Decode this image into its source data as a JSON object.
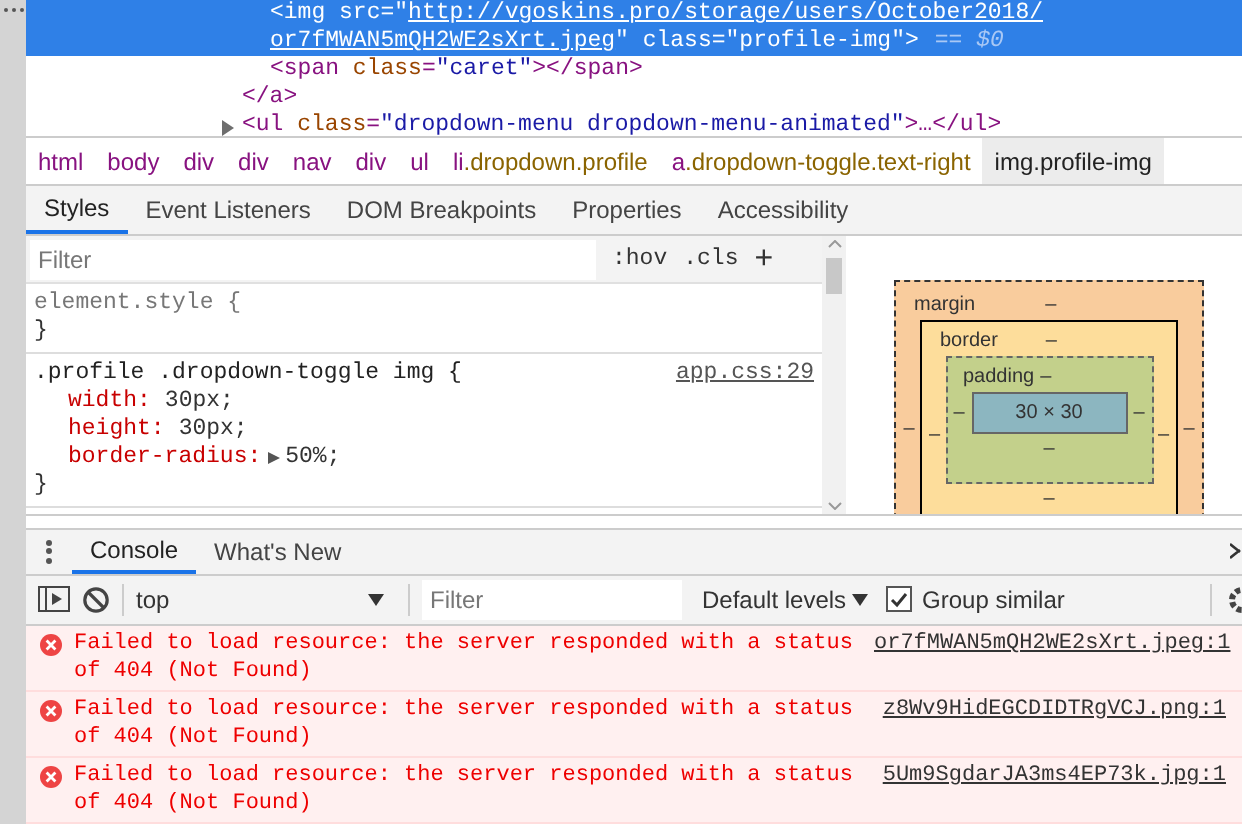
{
  "dom": {
    "inner_nodes": [
      {
        "selected": true,
        "expandable": false,
        "lines": [
          [
            {
              "kind": "tag",
              "text": "<img "
            },
            {
              "kind": "attr",
              "text": "src"
            },
            {
              "kind": "tag",
              "text": "=\""
            },
            {
              "kind": "link",
              "text": "http://vgoskins.pro/storage/users/October2018/"
            }
          ],
          [
            {
              "kind": "link",
              "text": "or7fMWAN5mQH2WE2sXrt.jpeg"
            },
            {
              "kind": "tag",
              "text": "\" "
            },
            {
              "kind": "attr",
              "text": "class"
            },
            {
              "kind": "tag",
              "text": "="
            },
            {
              "kind": "value",
              "text": "\"profile-img\""
            },
            {
              "kind": "tag",
              "text": ">"
            }
          ]
        ],
        "marker": "== $0"
      },
      {
        "selected": false,
        "expandable": false,
        "lines": [
          [
            {
              "kind": "tag",
              "text": "<span "
            },
            {
              "kind": "attr",
              "text": "class"
            },
            {
              "kind": "tag",
              "text": "="
            },
            {
              "kind": "value",
              "text": "\"caret\""
            },
            {
              "kind": "tag",
              "text": "></span>"
            }
          ]
        ]
      }
    ],
    "outer_nodes": [
      {
        "selected": false,
        "expandable": false,
        "lines": [
          [
            {
              "kind": "tag",
              "text": "</a>"
            }
          ]
        ]
      },
      {
        "selected": false,
        "expandable": true,
        "lines": [
          [
            {
              "kind": "tag",
              "text": "<ul "
            },
            {
              "kind": "attr",
              "text": "class"
            },
            {
              "kind": "tag",
              "text": "="
            },
            {
              "kind": "value",
              "text": "\"dropdown-menu dropdown-menu-animated\""
            },
            {
              "kind": "tag",
              "text": ">…</ul>"
            }
          ]
        ]
      }
    ]
  },
  "breadcrumbs": [
    {
      "tag": "html",
      "selected": false
    },
    {
      "tag": "body",
      "selected": false
    },
    {
      "tag": "div",
      "selected": false
    },
    {
      "tag": "div",
      "selected": false
    },
    {
      "tag": "nav",
      "selected": false
    },
    {
      "tag": "div",
      "selected": false
    },
    {
      "tag": "ul",
      "selected": false
    },
    {
      "tag": "li",
      "classes": ".dropdown.profile",
      "selected": false
    },
    {
      "tag": "a",
      "classes": ".dropdown-toggle.text-right",
      "selected": false
    },
    {
      "tag": "img",
      "classes": ".profile-img",
      "selected": true
    }
  ],
  "tabs": [
    {
      "label": "Styles",
      "selected": true
    },
    {
      "label": "Event Listeners",
      "selected": false
    },
    {
      "label": "DOM Breakpoints",
      "selected": false
    },
    {
      "label": "Properties",
      "selected": false
    },
    {
      "label": "Accessibility",
      "selected": false
    }
  ],
  "styles": {
    "filter": {
      "placeholder": "Filter"
    },
    "hov": ":hov",
    "cls": ".cls",
    "add": "+",
    "rules": [
      {
        "selector": "element.style {",
        "close": "}"
      },
      {
        "selector": ".profile .dropdown-toggle img {",
        "source": "app.css:29",
        "declarations": [
          {
            "name": "width:",
            "value": "30px;",
            "expandable": false
          },
          {
            "name": "height:",
            "value": "30px;",
            "expandable": false
          },
          {
            "name": "border-radius:",
            "value": "50%;",
            "expandable": true
          }
        ],
        "close": "}"
      }
    ]
  },
  "box_model": {
    "margin": {
      "label": "margin",
      "top": "–",
      "left": "–",
      "right": "–"
    },
    "border": {
      "label": "border",
      "top": "–",
      "left": "–",
      "right": "–",
      "bottom": "–"
    },
    "padding": {
      "label": "padding",
      "top": "–",
      "left": "–",
      "right": "–",
      "bottom": "–"
    },
    "content": "30 × 30"
  },
  "drawer": {
    "tabs": [
      {
        "label": "Console",
        "selected": true
      },
      {
        "label": "What's New",
        "selected": false
      }
    ],
    "toolbar": {
      "context": "top",
      "filter": {
        "placeholder": "Filter"
      },
      "levels": "Default levels",
      "group_similar": {
        "label": "Group similar",
        "checked": true
      }
    },
    "messages": [
      {
        "text": "Failed to load resource: the server responded with a status of 404 (Not Found)",
        "source": "or7fMWAN5mQH2WE2sXrt.jpeg:1"
      },
      {
        "text": "Failed to load resource: the server responded with a status of 404 (Not Found)",
        "source": "z8Wv9HidEGCDIDTRgVCJ.png:1"
      },
      {
        "text": "Failed to load resource: the server responded with a status of 404 (Not Found)",
        "source": "5Um9SgdarJA3ms4EP73k.jpg:1"
      }
    ]
  }
}
